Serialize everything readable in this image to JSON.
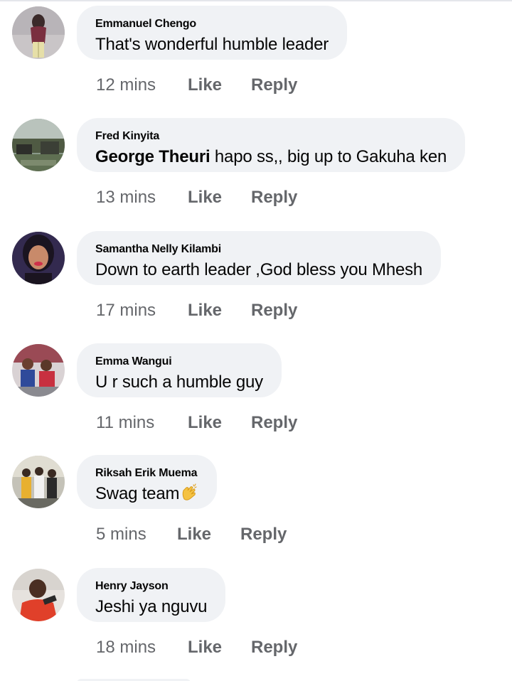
{
  "comments": [
    {
      "author": "Emmanuel Chengo",
      "mention": "",
      "text": "That's wonderful humble leader",
      "time": "12 mins",
      "like_label": "Like",
      "reply_label": "Reply",
      "avatar_icon": "profile-photo-person-standing"
    },
    {
      "author": "Fred Kinyita",
      "mention": "George Theuri",
      "text": " hapo ss,, big up to Gakuha ken",
      "time": "13 mins",
      "like_label": "Like",
      "reply_label": "Reply",
      "avatar_icon": "profile-photo-outdoor-scene"
    },
    {
      "author": "Samantha Nelly Kilambi",
      "mention": "",
      "text": "Down to earth leader ,God bless you Mhesh",
      "time": "17 mins",
      "like_label": "Like",
      "reply_label": "Reply",
      "avatar_icon": "profile-photo-woman-portrait"
    },
    {
      "author": "Emma Wangui",
      "mention": "",
      "text": "U r such a humble guy",
      "time": "11 mins",
      "like_label": "Like",
      "reply_label": "Reply",
      "avatar_icon": "profile-photo-group-people"
    },
    {
      "author": "Riksah Erik Muema",
      "mention": "",
      "text": "Swag team",
      "time": "5 mins",
      "like_label": "Like",
      "reply_label": "Reply",
      "avatar_icon": "profile-photo-group-standing",
      "emoji_icon": "clapping-hands-icon"
    },
    {
      "author": "Henry Jayson",
      "mention": "",
      "text": "Jeshi ya nguvu",
      "time": "18 mins",
      "like_label": "Like",
      "reply_label": "Reply",
      "avatar_icon": "profile-photo-man-red-shirt"
    }
  ],
  "colors": {
    "bubble_background": "#f0f2f5",
    "text_primary": "#050505",
    "text_secondary": "#65676b"
  }
}
